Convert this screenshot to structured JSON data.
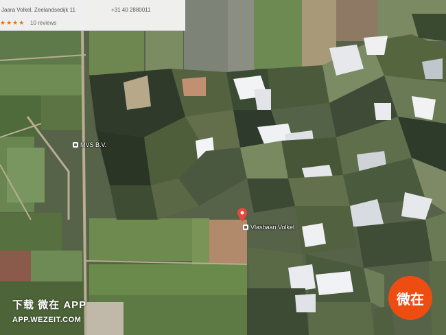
{
  "info_card": {
    "address": "Jaara Volkel, Zeelandsedijk 11",
    "phone": "+31 40 2880011",
    "rating_stars": "★★★★",
    "reviews": "10 reviews"
  },
  "map": {
    "view": "satellite",
    "labels": {
      "business_1": "MVS B.V.",
      "business_2": "Vlasbaan Volkel"
    },
    "pin_color": "#e8473b",
    "obscured_region": "pixelated mosaic over right half"
  },
  "watermark": {
    "line1": "下载 微在 APP",
    "line2": "APP.WEZEIT.COM",
    "badge_text": "微在",
    "badge_color": "#ee4d12"
  }
}
